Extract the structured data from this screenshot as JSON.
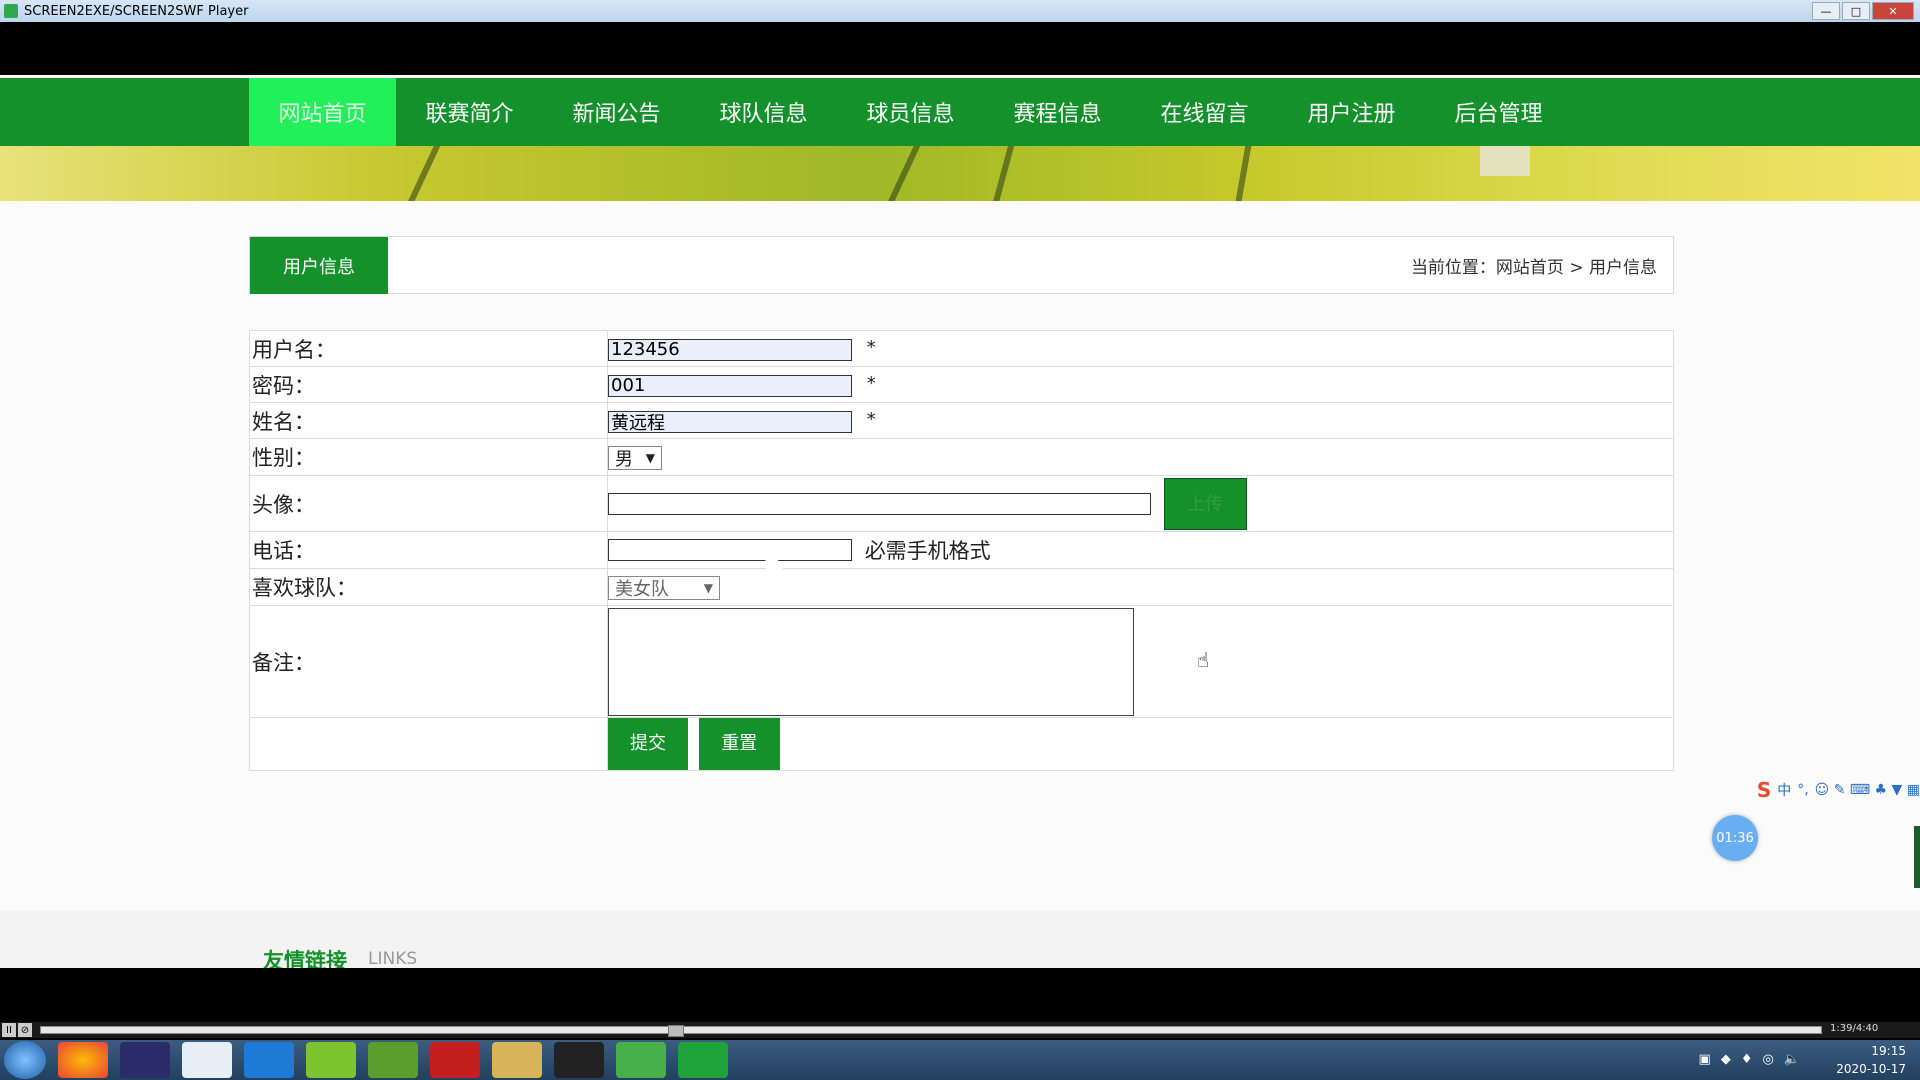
{
  "window": {
    "title": "SCREEN2EXE/SCREEN2SWF Player",
    "min": "—",
    "max": "□",
    "close": "✕"
  },
  "nav": {
    "items": [
      {
        "label": "网站首页"
      },
      {
        "label": "联赛简介"
      },
      {
        "label": "新闻公告"
      },
      {
        "label": "球队信息"
      },
      {
        "label": "球员信息"
      },
      {
        "label": "赛程信息"
      },
      {
        "label": "在线留言"
      },
      {
        "label": "用户注册"
      },
      {
        "label": "后台管理"
      }
    ],
    "active_index": 0
  },
  "section": {
    "tab": "用户信息",
    "breadcrumb": "当前位置：网站首页 > 用户信息"
  },
  "form": {
    "username_label": "用户名：",
    "username_value": "123456",
    "password_label": "密码：",
    "password_value": "001",
    "name_label": "姓名：",
    "name_value": "黄远程",
    "required_mark": "*",
    "gender_label": "性别：",
    "gender_value": "男",
    "avatar_label": "头像：",
    "avatar_value": "",
    "upload_label": "上传",
    "phone_label": "电话：",
    "phone_value": "",
    "phone_hint": "必需手机格式",
    "team_label": "喜欢球队：",
    "team_value": "美女队",
    "note_label": "备注：",
    "note_value": "",
    "submit_label": "提交",
    "reset_label": "重置"
  },
  "links": {
    "title": "友情链接",
    "subtitle": "LINKS"
  },
  "ime": {
    "logo": "S",
    "mode": "中",
    "punct": "°,",
    "icons": "☺ ✎ ⌨ ♣ ▼ ▦"
  },
  "timer": "01:36",
  "player": {
    "time": "1:39/4:40",
    "play": "II",
    "stop": "⊘"
  },
  "tray": {
    "time": "19:15",
    "date": "2020-10-17"
  },
  "colors": {
    "nav_green": "#14912b",
    "nav_active": "#22f05a"
  }
}
